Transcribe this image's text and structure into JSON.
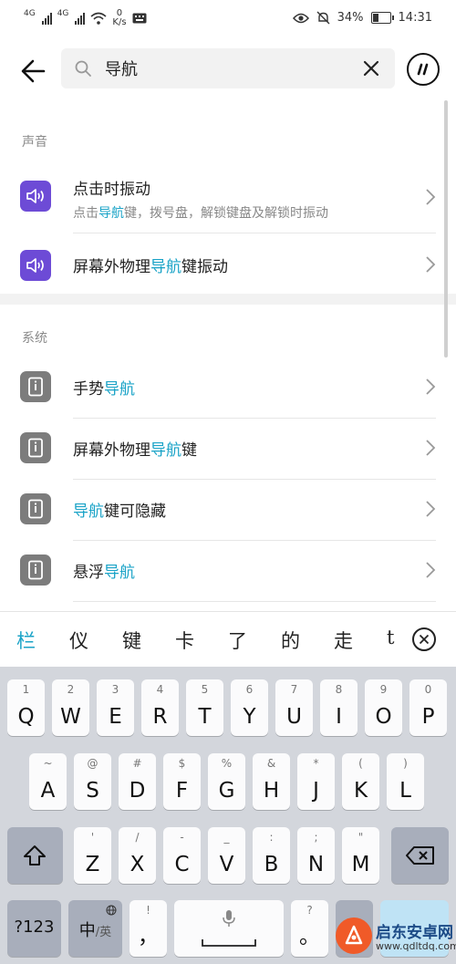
{
  "status_bar": {
    "net1": "4G",
    "net2": "4G",
    "speed_value": "0",
    "speed_unit": "K/s",
    "battery": "34%",
    "time": "14:31"
  },
  "search": {
    "query": "导航"
  },
  "sections": [
    {
      "label": "声音",
      "items": [
        {
          "title": "点击时振动",
          "subtitle_parts": [
            "点击",
            "导航",
            "键，拨号盘，解锁键盘及解锁时振动"
          ]
        },
        {
          "title_parts": [
            "屏幕外物理",
            "导航",
            "键振动"
          ]
        }
      ]
    },
    {
      "label": "系统",
      "items": [
        {
          "title_parts": [
            "手势",
            "导航",
            ""
          ]
        },
        {
          "title_parts": [
            "屏幕外物理",
            "导航",
            "键"
          ]
        },
        {
          "title_parts": [
            "",
            "导航",
            "键可隐藏"
          ]
        },
        {
          "title_parts": [
            "悬浮",
            "导航",
            ""
          ]
        }
      ]
    }
  ],
  "candidates": [
    "栏",
    "仪",
    "键",
    "卡",
    "了",
    "的",
    "走",
    "t"
  ],
  "keyboard": {
    "row1": [
      {
        "k": "Q",
        "h": "1"
      },
      {
        "k": "W",
        "h": "2"
      },
      {
        "k": "E",
        "h": "3"
      },
      {
        "k": "R",
        "h": "4"
      },
      {
        "k": "T",
        "h": "5"
      },
      {
        "k": "Y",
        "h": "6"
      },
      {
        "k": "U",
        "h": "7"
      },
      {
        "k": "I",
        "h": "8"
      },
      {
        "k": "O",
        "h": "9"
      },
      {
        "k": "P",
        "h": "0"
      }
    ],
    "row2": [
      {
        "k": "A",
        "h": "~"
      },
      {
        "k": "S",
        "h": "@"
      },
      {
        "k": "D",
        "h": "#"
      },
      {
        "k": "F",
        "h": "$"
      },
      {
        "k": "G",
        "h": "%"
      },
      {
        "k": "H",
        "h": "&"
      },
      {
        "k": "J",
        "h": "*"
      },
      {
        "k": "K",
        "h": "("
      },
      {
        "k": "L",
        "h": ")"
      }
    ],
    "row3": [
      {
        "k": "Z",
        "h": "'"
      },
      {
        "k": "X",
        "h": "/"
      },
      {
        "k": "C",
        "h": "-"
      },
      {
        "k": "V",
        "h": "_"
      },
      {
        "k": "B",
        "h": ":"
      },
      {
        "k": "N",
        "h": ";"
      },
      {
        "k": "M",
        "h": "\""
      }
    ],
    "sym_key": "?123",
    "lang_key_main": "中",
    "lang_key_sub": "/英",
    "comma_key": "，",
    "comma_hint": "!",
    "period_key": "。",
    "period_hint": "?"
  },
  "watermark": {
    "title": "启东安卓网",
    "url": "www.qdltdq.com"
  }
}
